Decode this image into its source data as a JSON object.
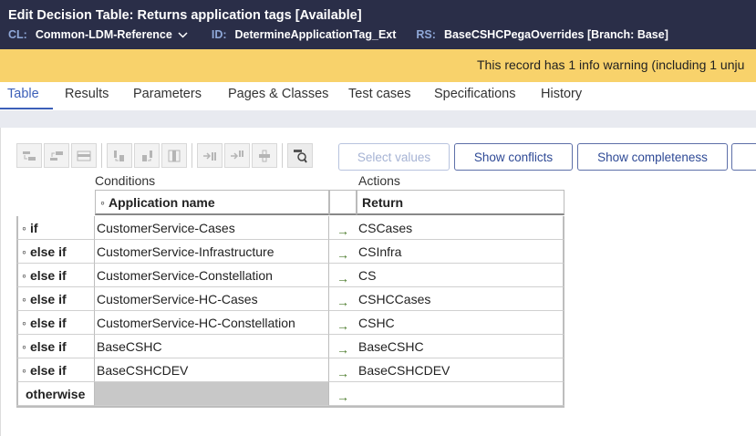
{
  "header": {
    "title_prefix": "Edit",
    "title": "Decision Table: Returns application tags",
    "status": "[Available]",
    "cl_label": "CL:",
    "cl_value": "Common-LDM-Reference",
    "id_label": "ID:",
    "id_value": "DetermineApplicationTag_Ext",
    "rs_label": "RS:",
    "rs_value": "BaseCSHCPegaOverrides [Branch: Base]"
  },
  "warning": {
    "text": "This record has 1 info warning (including 1 unju"
  },
  "tabs": [
    {
      "label": "Table"
    },
    {
      "label": "Results"
    },
    {
      "label": "Parameters"
    },
    {
      "label": "Pages & Classes"
    },
    {
      "label": "Test cases"
    },
    {
      "label": "Specifications"
    },
    {
      "label": "History"
    }
  ],
  "toolbar": {
    "select_values": "Select values",
    "show_conflicts": "Show conflicts",
    "show_completeness": "Show completeness"
  },
  "table": {
    "conditions_label": "Conditions",
    "actions_label": "Actions",
    "condition_header": "Application name",
    "action_header": "Return",
    "header_marker": "◦",
    "arrow": "→",
    "rows": [
      {
        "label": "if",
        "marker": "◦",
        "condition": "CustomerService-Cases",
        "action": "CSCases"
      },
      {
        "label": "else if",
        "marker": "◦",
        "condition": "CustomerService-Infrastructure",
        "action": "CSInfra"
      },
      {
        "label": "else if",
        "marker": "◦",
        "condition": "CustomerService-Constellation",
        "action": "CS"
      },
      {
        "label": "else if",
        "marker": "◦",
        "condition": "CustomerService-HC-Cases",
        "action": "CSHCCases"
      },
      {
        "label": "else if",
        "marker": "◦",
        "condition": "CustomerService-HC-Constellation",
        "action": "CSHC"
      },
      {
        "label": "else if",
        "marker": "◦",
        "condition": "BaseCSHC",
        "action": "BaseCSHC"
      },
      {
        "label": "else if",
        "marker": "◦",
        "condition": "BaseCSHCDEV",
        "action": "BaseCSHCDEV"
      },
      {
        "label": "otherwise",
        "marker": "",
        "condition": "",
        "action": ""
      }
    ]
  },
  "colors": {
    "header_bg": "#2a2e48",
    "warning_bg": "#f8d26b",
    "accent": "#3c5fb8"
  }
}
